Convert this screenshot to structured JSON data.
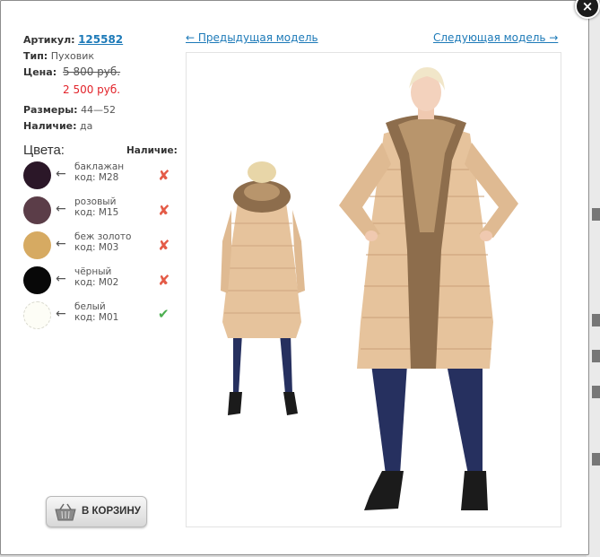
{
  "product": {
    "sku_label": "Артикул:",
    "sku_value": "125582",
    "type_label": "Тип:",
    "type_value": "Пуховик",
    "price_label": "Цена:",
    "old_price": "5 800 руб.",
    "new_price": "2 500 руб.",
    "sizes_label": "Размеры:",
    "sizes_value": "44—52",
    "stock_label": "Наличие:",
    "stock_value": "да"
  },
  "colors": {
    "title": "Цвета:",
    "availability_title": "Наличие:",
    "items": [
      {
        "name": "баклажан",
        "code": "код: M28",
        "swatch": "#2b1728",
        "available": false
      },
      {
        "name": "розовый",
        "code": "код: M15",
        "swatch": "#5b3d48",
        "available": false
      },
      {
        "name": "беж золото",
        "code": "код: M03",
        "swatch": "#d6aa62",
        "available": false
      },
      {
        "name": "чёрный",
        "code": "код: M02",
        "swatch": "#080808",
        "available": false
      },
      {
        "name": "белый",
        "code": "код: M01",
        "swatch": "#fdfdf6",
        "available": true
      }
    ]
  },
  "nav": {
    "prev": "← Предыдущая модель",
    "next": "Следующая модель →"
  },
  "cart": {
    "label": "В КОРЗИНУ"
  },
  "close": {
    "label": "×"
  },
  "theme": {
    "link_color": "#1d7ab8",
    "sale_price_color": "#e2232a",
    "unavailable_color": "#e45b47",
    "available_color": "#4caf50",
    "coat_color": "#e6c39c",
    "fur_color": "#8d6d4c",
    "jeans_color": "#26305f"
  }
}
